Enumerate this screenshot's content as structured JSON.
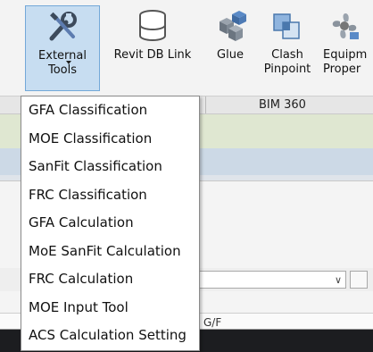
{
  "ribbon": {
    "buttons": [
      {
        "label1": "External",
        "label2": "Tools",
        "icon": "tools-icon"
      },
      {
        "label1": "Revit DB Link",
        "label2": "",
        "icon": "database-icon"
      },
      {
        "label1": "Glue",
        "label2": "",
        "icon": "cubes-icon"
      },
      {
        "label1": "Clash",
        "label2": "Pinpoint",
        "icon": "clash-pinpoint-icon"
      },
      {
        "label1": "Equipm",
        "label2": "Proper",
        "icon": "equipment-fan-icon"
      }
    ],
    "group_label": "BIM 360"
  },
  "menu": {
    "items": [
      "GFA Classification",
      "MOE Classification",
      "SanFit Classification",
      "FRC Classification",
      "GFA Calculation",
      "MoE SanFit Calculation",
      "FRC Calculation",
      "MOE Input Tool",
      "ACS Calculation Setting"
    ]
  },
  "background": {
    "field_text": "G/F"
  },
  "colors": {
    "ribbon_bg": "#f3f3f3",
    "selected_button_bg": "#c7ddf1",
    "selected_button_border": "#73a8d8",
    "menu_bg": "#ffffff"
  }
}
